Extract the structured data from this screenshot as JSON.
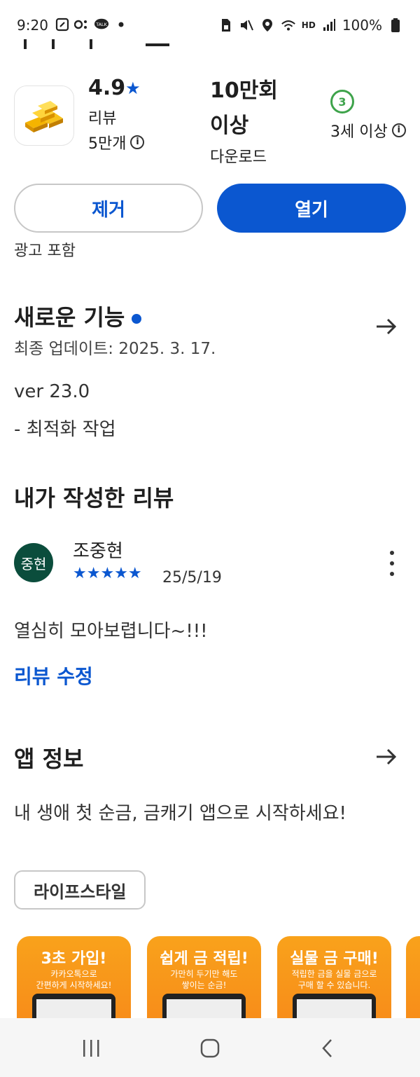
{
  "status_bar": {
    "time": "9:20",
    "battery": "100%",
    "hd_label": "HD",
    "talk_label": "TALK"
  },
  "app": {
    "rating": "4.9",
    "rating_star": "★",
    "reviews_label": "리뷰",
    "reviews_count": "5만개",
    "downloads_value_line1": "10만회",
    "downloads_value_line2": "이상",
    "downloads_label": "다운로드",
    "age_badge": "3",
    "age_label": "3세 이상",
    "icon": "gold-bars-icon"
  },
  "actions": {
    "remove_label": "제거",
    "open_label": "열기",
    "ads_notice": "광고 포함"
  },
  "whats_new": {
    "title": "새로운 기능",
    "updated": "최종 업데이트: 2025. 3. 17.",
    "version": "ver 23.0",
    "notes": "- 최적화 작업"
  },
  "my_review": {
    "title": "내가 작성한 리뷰",
    "avatar_text": "중현",
    "reviewer": "조중현",
    "stars": "★★★★★",
    "date": "25/5/19",
    "text": "열심히 모아보렵니다~!!!",
    "edit_label": "리뷰 수정"
  },
  "app_info": {
    "title": "앱 정보",
    "description": "내 생애 첫 순금, 금캐기 앱으로 시작하세요!",
    "category_chip": "라이프스타일"
  },
  "screenshots": [
    {
      "headline": "3초 가입!",
      "sub1": "카카오톡으로",
      "sub2": "간편하게 시작하세요!"
    },
    {
      "headline": "쉽게 금 적립!",
      "sub1": "가만히 두기만 해도",
      "sub2": "쌓이는 순금!"
    },
    {
      "headline": "실물 금 구매!",
      "sub1": "적립한 금을 실물 금으로",
      "sub2": "구매 할 수 있습니다."
    }
  ],
  "colors": {
    "accent": "#0b57d0",
    "age_green": "#3ea34b",
    "avatar_bg": "#0b4d3c",
    "shot_orange": "#f9a21b"
  }
}
